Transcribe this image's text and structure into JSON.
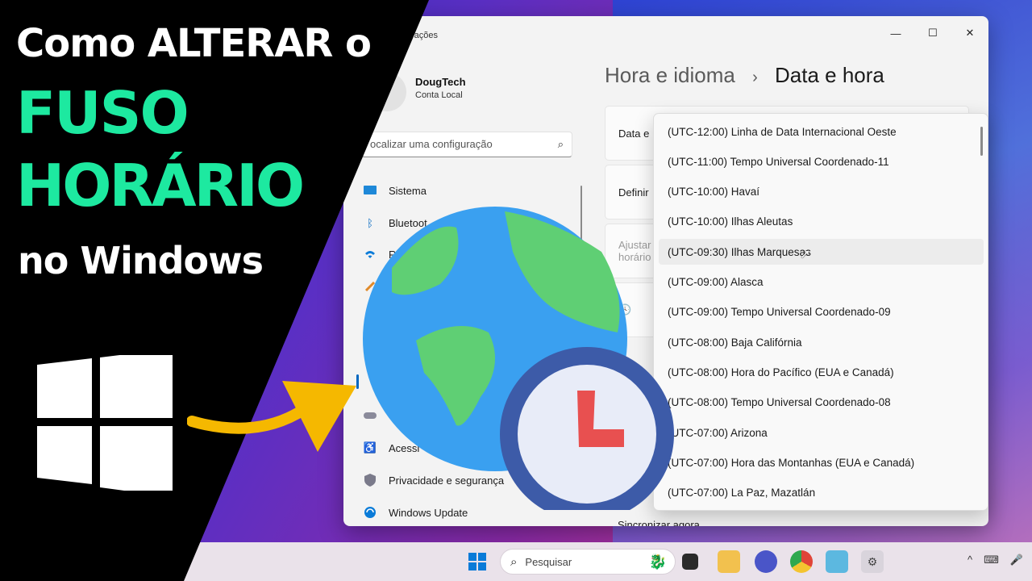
{
  "promo": {
    "line1": "Como ALTERAR o",
    "line2": "FUSO",
    "line3": "HORÁRIO",
    "line4": "no Windows",
    "accent_color": "#1de9a0"
  },
  "window": {
    "title": "rações",
    "controls": {
      "minimize": "—",
      "maximize": "☐",
      "close": "✕"
    }
  },
  "profile": {
    "name": "DougTech",
    "account": "Conta Local"
  },
  "search": {
    "value": "ocalizar uma configuração"
  },
  "nav": [
    {
      "label": "Sistema",
      "icon": "monitor-icon"
    },
    {
      "label": "Bluetoot",
      "icon": "bluetooth-icon"
    },
    {
      "label": "R",
      "icon": "wifi-icon"
    },
    {
      "label": "",
      "icon": "personalization-icon"
    },
    {
      "label": "",
      "icon": "apps-icon"
    },
    {
      "label": "",
      "icon": "time-language-icon"
    },
    {
      "label": "",
      "icon": "gaming-icon"
    },
    {
      "label": "Acessi",
      "icon": "accessibility-icon"
    },
    {
      "label": "Privacidade e segurança",
      "icon": "shield-icon"
    },
    {
      "label": "Windows Update",
      "icon": "update-icon"
    }
  ],
  "breadcrumb": {
    "parent": "Hora e idioma",
    "separator": "›",
    "current": "Data e hora"
  },
  "cards": {
    "date": "Data e",
    "set": "Definir",
    "adjust_1": "Ajustar",
    "adjust_2": "horário",
    "sync": "Sincronizar agora"
  },
  "timezones": [
    "(UTC-12:00) Linha de Data Internacional Oeste",
    "(UTC-11:00) Tempo Universal Coordenado-11",
    "(UTC-10:00) Havaí",
    "(UTC-10:00) Ilhas Aleutas",
    "(UTC-09:30) Ilhas Marquesas",
    "(UTC-09:00) Alasca",
    "(UTC-09:00) Tempo Universal Coordenado-09",
    "(UTC-08:00) Baja Califórnia",
    "(UTC-08:00) Hora do Pacífico (EUA e Canadá)",
    "(UTC-08:00) Tempo Universal Coordenado-08",
    "(UTC-07:00) Arizona",
    "(UTC-07:00) Hora das Montanhas (EUA e Canadá)",
    "(UTC-07:00) La Paz, Mazatlán"
  ],
  "hovered_timezone_index": 4,
  "taskbar": {
    "search_placeholder": "Pesquisar"
  }
}
